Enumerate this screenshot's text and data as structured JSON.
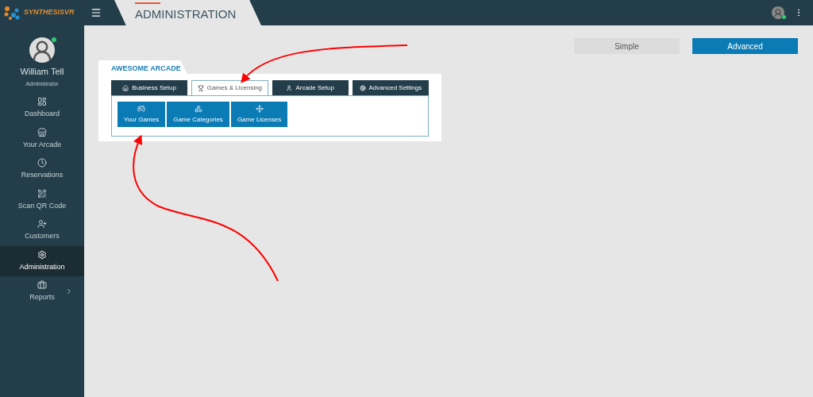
{
  "brand": "SYNTHESISVR",
  "header": {
    "title": "ADMINISTRATION"
  },
  "user": {
    "name": "William Tell",
    "role": "Administrator"
  },
  "sidebar": {
    "items": [
      {
        "label": "Dashboard",
        "kind": "link",
        "selected": false
      },
      {
        "label": "Your Arcade",
        "kind": "link",
        "selected": false
      },
      {
        "label": "Reservations",
        "kind": "link",
        "selected": false
      },
      {
        "label": "Scan QR Code",
        "kind": "link",
        "selected": false
      },
      {
        "label": "Customers",
        "kind": "link",
        "selected": false
      },
      {
        "label": "Administration",
        "kind": "link",
        "selected": true
      },
      {
        "label": "Reports",
        "kind": "submenu",
        "selected": false
      }
    ]
  },
  "modes": [
    {
      "label": "Simple",
      "selected": false
    },
    {
      "label": "Advanced",
      "selected": true
    }
  ],
  "card": {
    "title": "AWESOME ARCADE",
    "tabs": [
      {
        "label": "Business Setup",
        "selected": false
      },
      {
        "label": "Games & Licensing",
        "selected": true
      },
      {
        "label": "Arcade Setup",
        "selected": false
      },
      {
        "label": "Advanced Settings",
        "selected": false
      }
    ],
    "tiles": [
      {
        "label": "Your Games"
      },
      {
        "label": "Game Categories"
      },
      {
        "label": "Game Licenses"
      }
    ]
  }
}
